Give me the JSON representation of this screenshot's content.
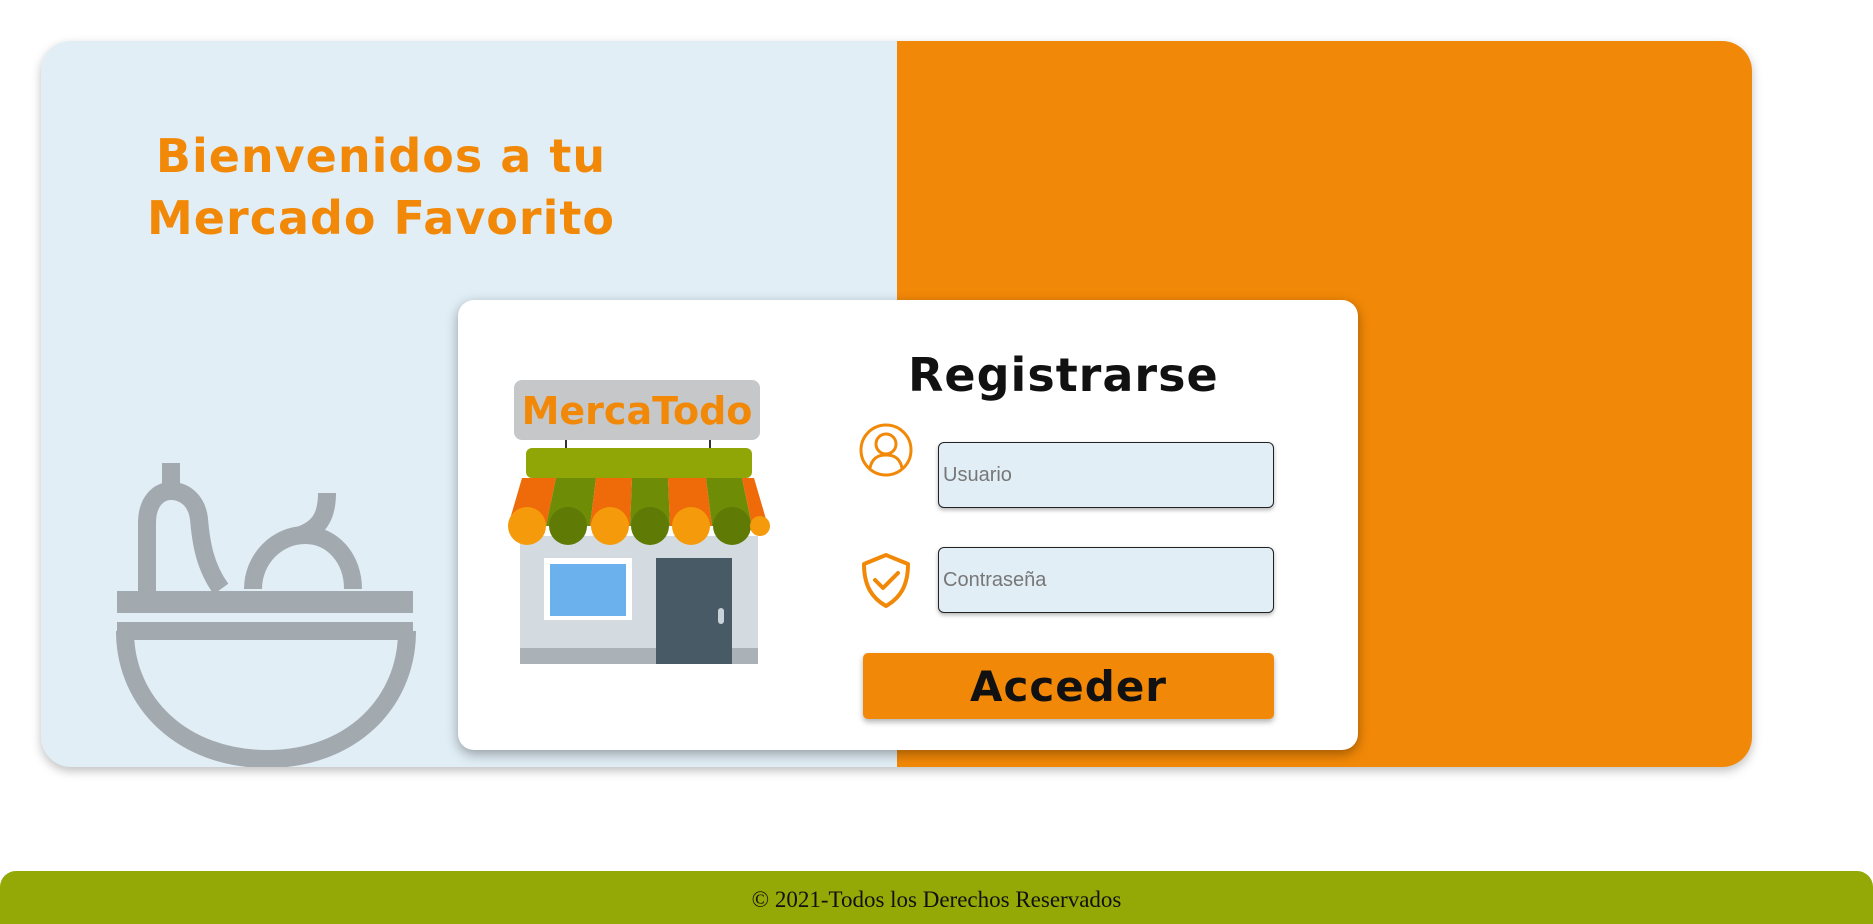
{
  "welcome": {
    "line1": "Bienvenidos a tu",
    "line2": "Mercado Favorito"
  },
  "store_logo": {
    "sign_text": "MercaTodo",
    "icon": "store-icon"
  },
  "form": {
    "title": "Registrarse",
    "username": {
      "placeholder": "Usuario",
      "value": "",
      "icon": "user-icon"
    },
    "password": {
      "placeholder": "Contraseña",
      "value": "",
      "icon": "shield-check-icon"
    },
    "submit_label": "Acceder"
  },
  "decorations": {
    "left_icon": "fruit-basket-icon",
    "right_icon": "cherry-icon"
  },
  "footer": {
    "text": "© 2021-Todos los Derechos Reservados"
  },
  "colors": {
    "accent": "#f28807",
    "light_panel": "#e1eef6",
    "footer": "#94a806",
    "cherry_shade": "#c46d00",
    "basket_gray": "#a3aaaf"
  }
}
